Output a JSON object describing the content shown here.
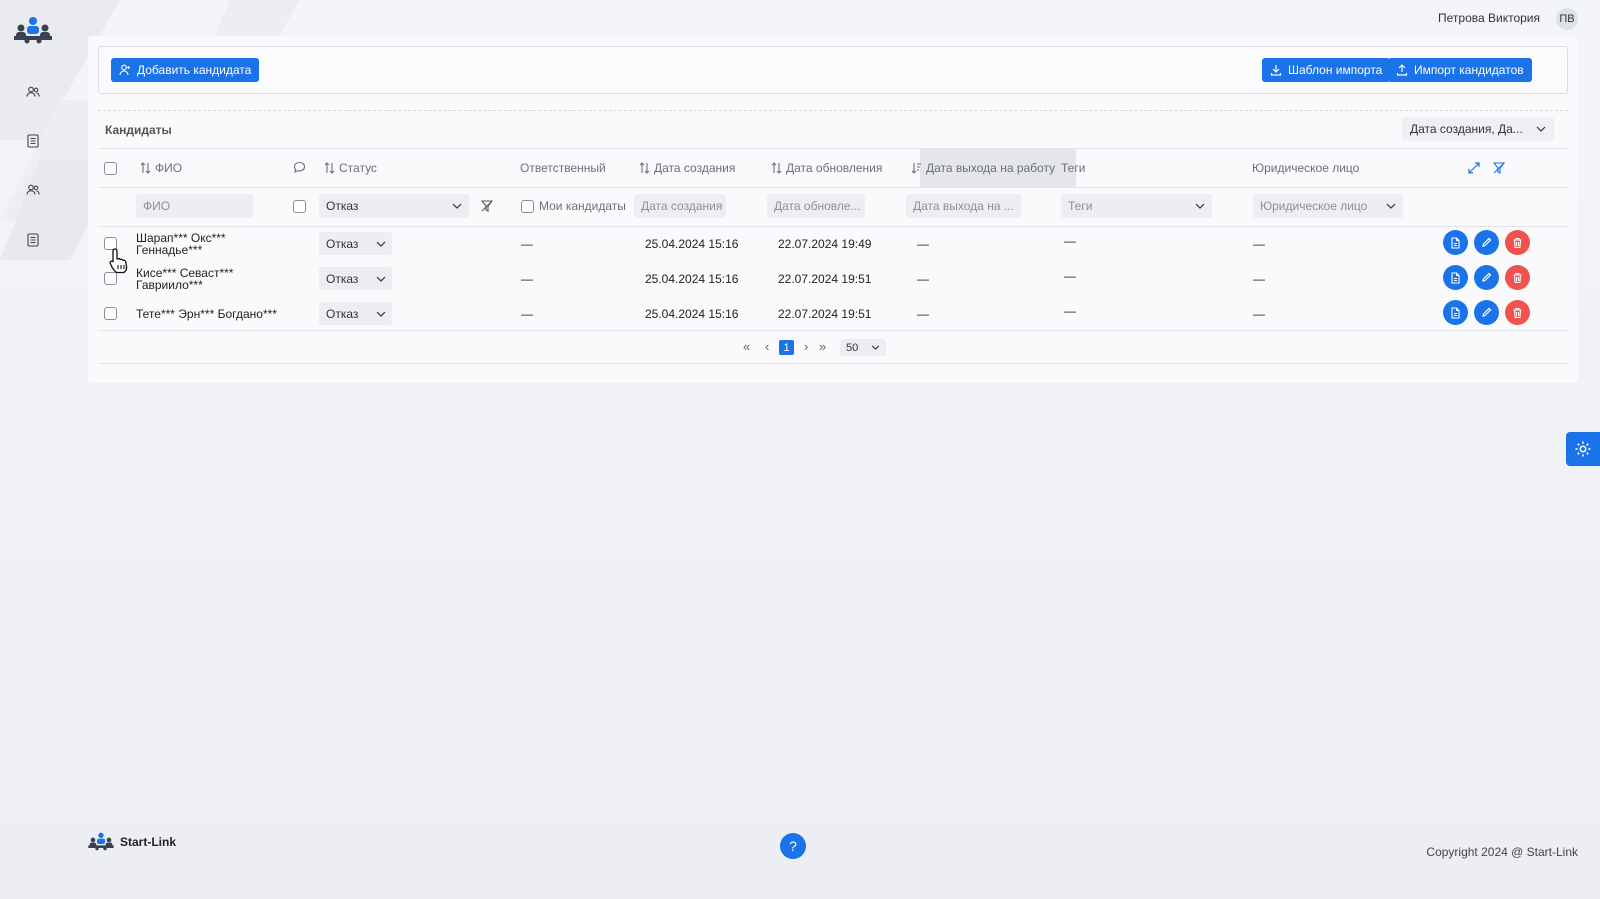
{
  "user": {
    "name": "Петрова Виктория",
    "initials": "ПВ"
  },
  "toolbar": {
    "add_candidate": "Добавить кандидата",
    "import_template": "Шаблон импорта",
    "import_candidates": "Импорт кандидатов"
  },
  "section": {
    "title": "Кандидаты",
    "sort_value": "Дата создания, Да..."
  },
  "table": {
    "headers": {
      "fio": "ФИО",
      "status": "Статус",
      "responsible": "Ответственный",
      "created": "Дата создания",
      "updated": "Дата обновления",
      "start_date": "Дата выхода на работу",
      "tags": "Теги",
      "legal_entity": "Юридическое лицо"
    },
    "filters": {
      "fio_placeholder": "ФИО",
      "status_value": "Отказ",
      "my_candidates": "Мои кандидаты",
      "created_placeholder": "Дата создания",
      "updated_placeholder": "Дата обновле...",
      "start_placeholder": "Дата выхода на ...",
      "tags_placeholder": "Теги",
      "legal_placeholder": "Юридическое лицо"
    },
    "rows": [
      {
        "fio_line1": "Шарап*** Окс***",
        "fio_line2": "Геннадье***",
        "status": "Отказ",
        "responsible": "—",
        "created": "25.04.2024 15:16",
        "updated": "22.07.2024 19:49",
        "start_date": "—",
        "tags": "—",
        "legal_entity": "—"
      },
      {
        "fio_line1": "Кисе*** Севаст***",
        "fio_line2": "Гавриило***",
        "status": "Отказ",
        "responsible": "—",
        "created": "25.04.2024 15:16",
        "updated": "22.07.2024 19:51",
        "start_date": "—",
        "tags": "—",
        "legal_entity": "—"
      },
      {
        "fio_line1": "Тете*** Эрн*** Богдано***",
        "fio_line2": "",
        "status": "Отказ",
        "responsible": "—",
        "created": "25.04.2024 15:16",
        "updated": "22.07.2024 19:51",
        "start_date": "—",
        "tags": "—",
        "legal_entity": "—"
      }
    ]
  },
  "pagination": {
    "current_page": "1",
    "page_size": "50",
    "first": "«",
    "prev": "‹",
    "next": "›",
    "last": "»"
  },
  "footer": {
    "brand": "Start-Link",
    "copyright": "Copyright 2024 @ Start-Link",
    "help": "?"
  },
  "colors": {
    "primary": "#1a73e8",
    "danger": "#ef5350",
    "background": "#f0f1f5"
  },
  "icons": {
    "sidebar": [
      "users-icon",
      "document-icon",
      "users-icon",
      "document-icon"
    ],
    "row_actions": [
      "file-icon",
      "edit-pencil-icon",
      "trash-icon"
    ]
  }
}
